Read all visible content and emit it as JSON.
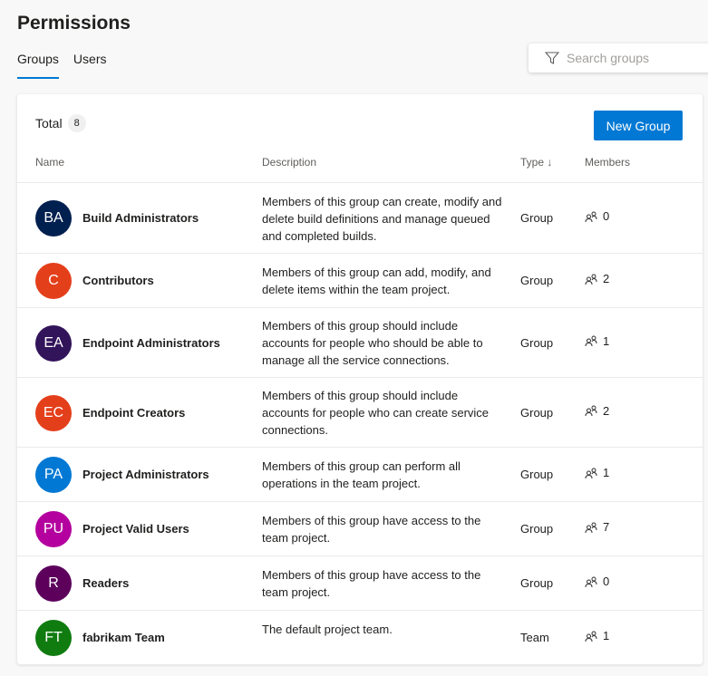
{
  "page": {
    "title": "Permissions"
  },
  "tabs": [
    {
      "label": "Groups",
      "active": true
    },
    {
      "label": "Users",
      "active": false
    }
  ],
  "search": {
    "placeholder": "Search groups",
    "icon": "filter-icon"
  },
  "toolbar": {
    "total_label": "Total",
    "total_count": "8",
    "new_group_label": "New Group"
  },
  "columns": {
    "name": "Name",
    "description": "Description",
    "type": "Type",
    "type_sort_icon": "arrow-down",
    "members": "Members"
  },
  "groups": [
    {
      "initials": "BA",
      "color": "#002050",
      "name": "Build Administrators",
      "description": "Members of this group can create, modify and delete build definitions and manage queued and completed builds.",
      "type": "Group",
      "members": "0"
    },
    {
      "initials": "C",
      "color": "#e43f1b",
      "name": "Contributors",
      "description": "Members of this group can add, modify, and delete items within the team project.",
      "type": "Group",
      "members": "2"
    },
    {
      "initials": "EA",
      "color": "#32145a",
      "name": "Endpoint Administrators",
      "description": "Members of this group should include accounts for people who should be able to manage all the service connections.",
      "type": "Group",
      "members": "1"
    },
    {
      "initials": "EC",
      "color": "#e43f1b",
      "name": "Endpoint Creators",
      "description": "Members of this group should include accounts for people who can create service connections.",
      "type": "Group",
      "members": "2"
    },
    {
      "initials": "PA",
      "color": "#0078d4",
      "name": "Project Administrators",
      "description": "Members of this group can perform all operations in the team project.",
      "type": "Group",
      "members": "1"
    },
    {
      "initials": "PU",
      "color": "#b4009e",
      "name": "Project Valid Users",
      "description": "Members of this group have access to the team project.",
      "type": "Group",
      "members": "7"
    },
    {
      "initials": "R",
      "color": "#5c005c",
      "name": "Readers",
      "description": "Members of this group have access to the team project.",
      "type": "Group",
      "members": "0"
    },
    {
      "initials": "FT",
      "color": "#107c10",
      "name": "fabrikam Team",
      "description": "The default project team.",
      "type": "Team",
      "members": "1"
    }
  ]
}
